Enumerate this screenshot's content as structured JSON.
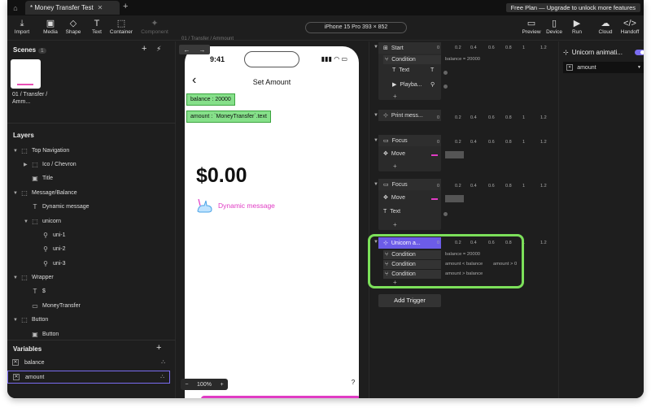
{
  "tabs": {
    "doc_title": "* Money Transfer Test",
    "plan_banner": "Free Plan — Upgrade to unlock more features"
  },
  "toolbar": {
    "import": "Import",
    "media": "Media",
    "shape": "Shape",
    "text": "Text",
    "container": "Container",
    "component": "Component",
    "device": "iPhone 15 Pro  393 × 852",
    "preview": "Preview",
    "device_btn": "Device",
    "run": "Run",
    "cloud": "Cloud",
    "handoff": "Handoff"
  },
  "scenes": {
    "title": "Scenes",
    "count": "1",
    "scene_name": "01 / Transfer / Amm..."
  },
  "layers": {
    "title": "Layers",
    "items": [
      {
        "label": "Top Navigation"
      },
      {
        "label": "Ico / Chevron"
      },
      {
        "label": "Title"
      },
      {
        "label": "Message/Balance"
      },
      {
        "label": "Dynamic message"
      },
      {
        "label": "unicorn"
      },
      {
        "label": "uni-1"
      },
      {
        "label": "uni-2"
      },
      {
        "label": "uni-3"
      },
      {
        "label": "Wrapper"
      },
      {
        "label": "$"
      },
      {
        "label": "MoneyTransfer"
      },
      {
        "label": "Button"
      },
      {
        "label": "Button"
      }
    ]
  },
  "variables": {
    "title": "Variables",
    "items": [
      {
        "name": "balance"
      },
      {
        "name": "amount"
      }
    ]
  },
  "canvas": {
    "breadcrumb": "01 / Transfer / Ammount",
    "time": "9:41",
    "screen_title": "Set Amount",
    "balance_tag": "balance : 20000",
    "amount_tag": "amount : `MoneyTransfer`.text",
    "amount_value": "$0.00",
    "dynamic_message": "Dynamic message",
    "zoom": "100%"
  },
  "timeline": {
    "ticks": [
      "0",
      "0.2",
      "0.4",
      "0.6",
      "0.8",
      "1",
      "1.2"
    ],
    "start": "Start",
    "condition": "Condition",
    "cond_balance": "balance = 20000",
    "text": "Text",
    "playback": "Playba...",
    "print": "Print mess...",
    "focus": "Focus",
    "move": "Move",
    "unicorn": "Unicorn a...",
    "cond_lt": "amount < balance",
    "cond_gt0": "amount > 0",
    "cond_gt": "amount > balance",
    "add_trigger": "Add Trigger"
  },
  "right": {
    "title": "Unicorn animati...",
    "variable": "amount"
  },
  "colors": {
    "accent": "#7a6cf0",
    "pink": "#e03bc4",
    "green": "#7ce05a"
  }
}
